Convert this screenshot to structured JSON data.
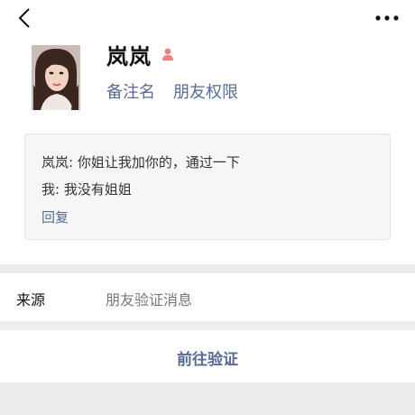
{
  "profile": {
    "name": "岚岚",
    "gender_icon": "female-person-icon",
    "remark_link": "备注名",
    "permission_link": "朋友权限"
  },
  "messages": {
    "line1": "岚岚: 你姐让我加你的，通过一下",
    "line2": "我: 我没有姐姐",
    "reply": "回复"
  },
  "source": {
    "label": "来源",
    "value": "朋友验证消息"
  },
  "action": {
    "verify": "前往验证"
  },
  "colors": {
    "link": "#576b95",
    "gender": "#e9837e",
    "separator": "#ededed"
  }
}
